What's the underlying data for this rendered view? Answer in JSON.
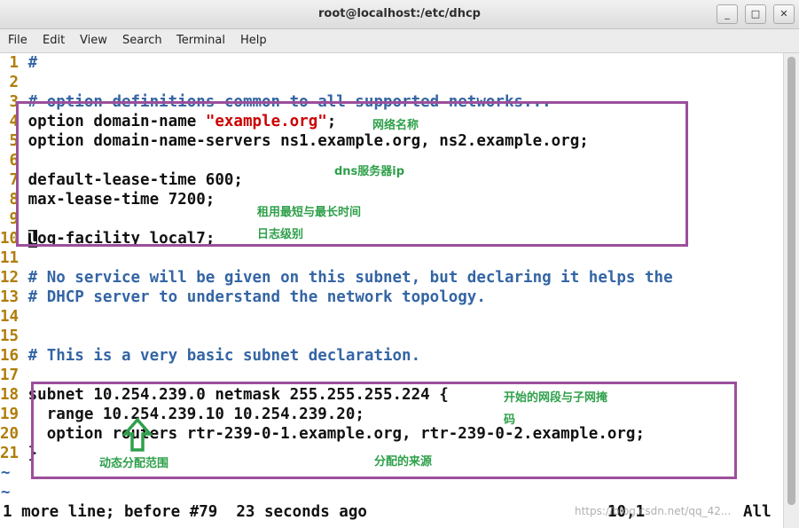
{
  "window": {
    "title": "root@localhost:/etc/dhcp",
    "minimize": "_",
    "maximize": "□",
    "close": "✕"
  },
  "menu": [
    "File",
    "Edit",
    "View",
    "Search",
    "Terminal",
    "Help"
  ],
  "lines": [
    {
      "n": " 1",
      "text": "#"
    },
    {
      "n": " 2",
      "text": ""
    },
    {
      "n": " 3",
      "text": "# option definitions common to all supported networks..."
    },
    {
      "n": " 4",
      "a": "option domain-name ",
      "s": "\"example.org\"",
      "b": ";"
    },
    {
      "n": " 5",
      "text": "option domain-name-servers ns1.example.org, ns2.example.org;"
    },
    {
      "n": " 6",
      "text": ""
    },
    {
      "n": " 7",
      "text": "default-lease-time 600;"
    },
    {
      "n": " 8",
      "text": "max-lease-time 7200;"
    },
    {
      "n": " 9",
      "text": ""
    },
    {
      "n": "10",
      "cur": "l",
      "rest": "og-facility local7;"
    },
    {
      "n": "11",
      "text": ""
    },
    {
      "n": "12",
      "text": "# No service will be given on this subnet, but declaring it helps the"
    },
    {
      "n": "13",
      "text": "# DHCP server to understand the network topology."
    },
    {
      "n": "14",
      "text": ""
    },
    {
      "n": "15",
      "text": ""
    },
    {
      "n": "16",
      "text": "# This is a very basic subnet declaration."
    },
    {
      "n": "17",
      "text": ""
    },
    {
      "n": "18",
      "text": "subnet 10.254.239.0 netmask 255.255.255.224 {"
    },
    {
      "n": "19",
      "text": "  range 10.254.239.10 10.254.239.20;"
    },
    {
      "n": "20",
      "text": "  option routers rtr-239-0-1.example.org, rtr-239-0-2.example.org;"
    },
    {
      "n": "21",
      "text": "}"
    }
  ],
  "tilde": "~",
  "status": {
    "message": "1 more line; before #79  23 seconds ago",
    "position": "10,1",
    "scroll": "All"
  },
  "annotations": {
    "network_name": "网络名称",
    "dns_ip": "dns服务器ip",
    "lease_time": "租用最短与最长时间",
    "log_level": "日志级别",
    "subnet_mask_1": "开始的网段与子网掩",
    "subnet_mask_2": "码",
    "dynamic_range": "动态分配范围",
    "allocation_source": "分配的来源"
  },
  "watermark": "https://blog.csdn.net/qq_42..."
}
